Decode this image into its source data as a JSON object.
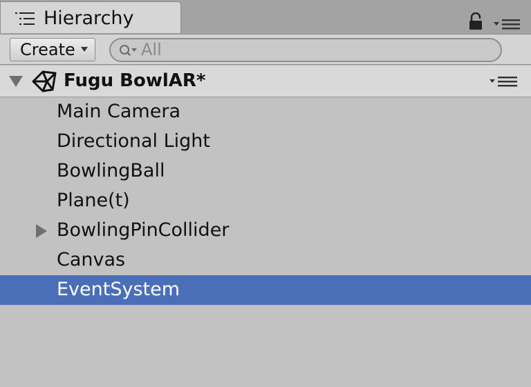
{
  "tab": {
    "title": "Hierarchy",
    "icon": "hierarchy-list-icon"
  },
  "toolbar": {
    "create_label": "Create",
    "search_placeholder": "All"
  },
  "scene": {
    "title": "Fugu BowlAR*",
    "icon": "unity-logo-icon",
    "expanded": true
  },
  "items": [
    {
      "label": "Main Camera",
      "has_children": false,
      "selected": false
    },
    {
      "label": "Directional Light",
      "has_children": false,
      "selected": false
    },
    {
      "label": "BowlingBall",
      "has_children": false,
      "selected": false
    },
    {
      "label": "Plane(t)",
      "has_children": false,
      "selected": false
    },
    {
      "label": "BowlingPinCollider",
      "has_children": true,
      "selected": false
    },
    {
      "label": "Canvas",
      "has_children": false,
      "selected": false
    },
    {
      "label": "EventSystem",
      "has_children": false,
      "selected": true
    }
  ],
  "colors": {
    "panel_background": "#c2c2c2",
    "selection": "#4a6eb8",
    "selected_text": "#ffffff",
    "text": "#111111",
    "placeholder_text": "#8a8a8a"
  }
}
